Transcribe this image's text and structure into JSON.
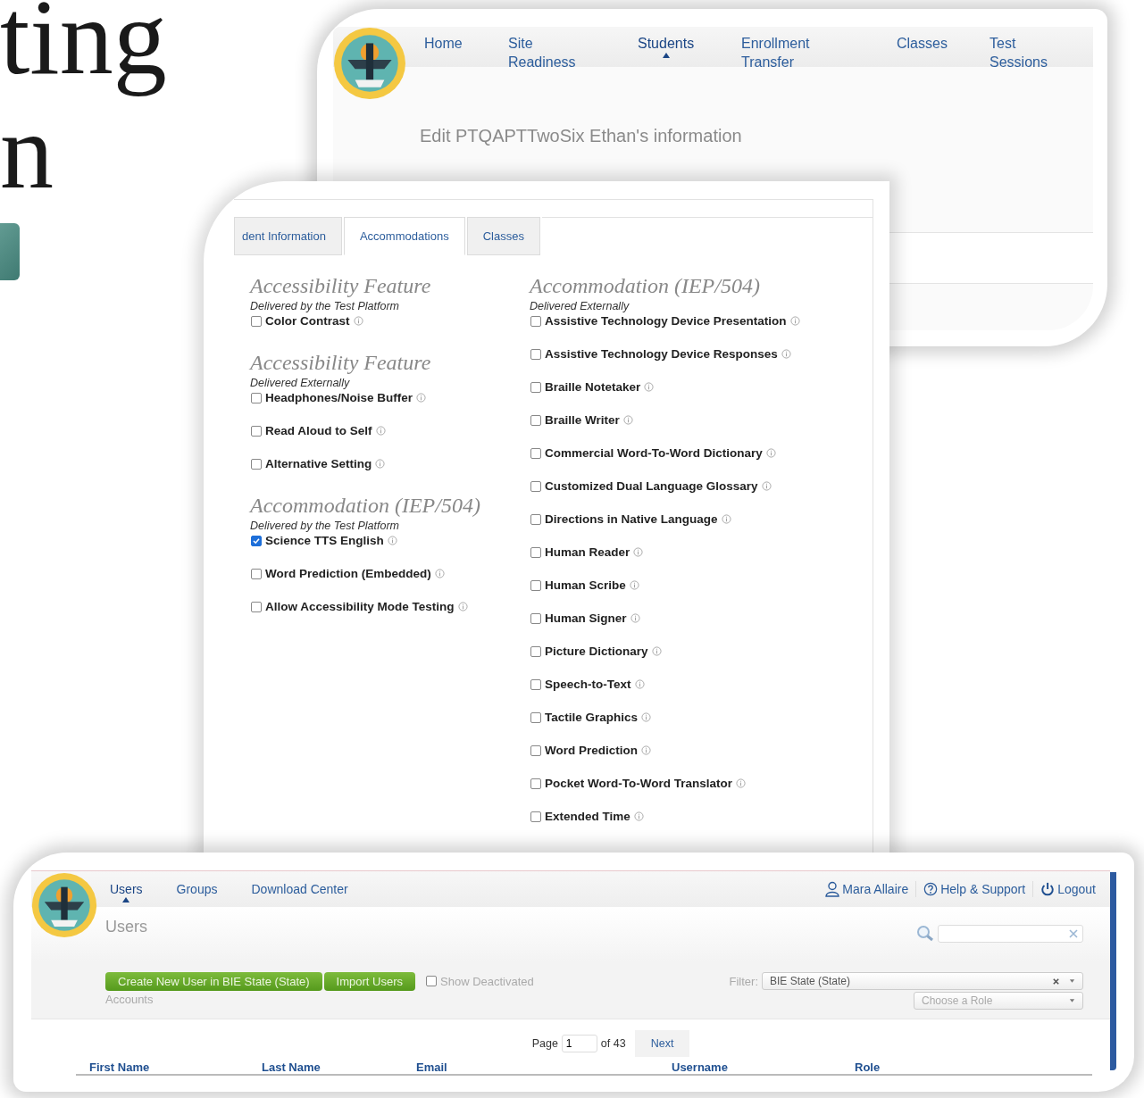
{
  "slide": {
    "title_lines": [
      "ting",
      "n"
    ]
  },
  "edit_window": {
    "nav": [
      {
        "label": "Home",
        "selected": false
      },
      {
        "label": "Site Readiness",
        "selected": false
      },
      {
        "label": "Students",
        "selected": true
      },
      {
        "label": "Enrollment Transfer",
        "selected": false
      },
      {
        "label": "Classes",
        "selected": false
      },
      {
        "label": "Test Sessions",
        "selected": false
      }
    ],
    "title": "Edit PTQAPTTwoSix Ethan's information"
  },
  "student_form": {
    "tabs": [
      {
        "label": "dent Information",
        "selected": false
      },
      {
        "label": "Accommodations",
        "selected": true
      },
      {
        "label": "Classes",
        "selected": false
      }
    ],
    "left_sections": [
      {
        "heading": "Accessibility Feature",
        "subheading": "Delivered by the Test Platform",
        "items": [
          {
            "label": "Color Contrast",
            "checked": false
          }
        ]
      },
      {
        "heading": "Accessibility Feature",
        "subheading": "Delivered Externally",
        "items": [
          {
            "label": "Headphones/Noise Buffer",
            "checked": false
          },
          {
            "label": "Read Aloud to Self",
            "checked": false
          },
          {
            "label": "Alternative Setting",
            "checked": false
          }
        ]
      },
      {
        "heading": "Accommodation (IEP/504)",
        "subheading": "Delivered by the Test Platform",
        "items": [
          {
            "label": "Science TTS English",
            "checked": true
          },
          {
            "label": "Word Prediction (Embedded)",
            "checked": false
          },
          {
            "label": "Allow Accessibility Mode Testing",
            "checked": false
          }
        ]
      }
    ],
    "right_sections": [
      {
        "heading": "Accommodation (IEP/504)",
        "subheading": "Delivered Externally",
        "items": [
          {
            "label": "Assistive Technology Device Presentation",
            "checked": false
          },
          {
            "label": "Assistive Technology Device Responses",
            "checked": false
          },
          {
            "label": "Braille Notetaker",
            "checked": false
          },
          {
            "label": "Braille Writer",
            "checked": false
          },
          {
            "label": "Commercial Word-To-Word Dictionary",
            "checked": false
          },
          {
            "label": "Customized Dual Language Glossary",
            "checked": false
          },
          {
            "label": "Directions in Native Language",
            "checked": false
          },
          {
            "label": "Human Reader",
            "checked": false
          },
          {
            "label": "Human Scribe",
            "checked": false
          },
          {
            "label": "Human Signer",
            "checked": false
          },
          {
            "label": "Picture Dictionary",
            "checked": false
          },
          {
            "label": "Speech-to-Text",
            "checked": false
          },
          {
            "label": "Tactile Graphics",
            "checked": false
          },
          {
            "label": "Word Prediction",
            "checked": false
          },
          {
            "label": "Pocket Word-To-Word Translator",
            "checked": false
          },
          {
            "label": "Extended Time",
            "checked": false
          }
        ]
      }
    ]
  },
  "users_window": {
    "nav": [
      {
        "label": "Users",
        "selected": true
      },
      {
        "label": "Groups",
        "selected": false
      },
      {
        "label": "Download Center",
        "selected": false
      }
    ],
    "user_menu": [
      {
        "kind": "user",
        "label": "Mara Allaire"
      },
      {
        "kind": "help",
        "label": "Help & Support"
      },
      {
        "kind": "logout",
        "label": "Logout"
      }
    ],
    "title": "Users",
    "buttons": [
      "Create New User in BIE State (State)",
      "Import Users"
    ],
    "show_deactivated": {
      "label_lines": [
        "Show Deactivated",
        "Accounts"
      ],
      "checked": false
    },
    "filter": {
      "label": "Filter:",
      "value": "BIE State (State)"
    },
    "role_select": {
      "placeholder": "Choose a Role"
    },
    "pager": {
      "label": "Page",
      "value": "1",
      "total": "of 43",
      "next": "Next"
    },
    "columns": [
      "First Name",
      "Last Name",
      "Email",
      "Username",
      "Role"
    ]
  }
}
